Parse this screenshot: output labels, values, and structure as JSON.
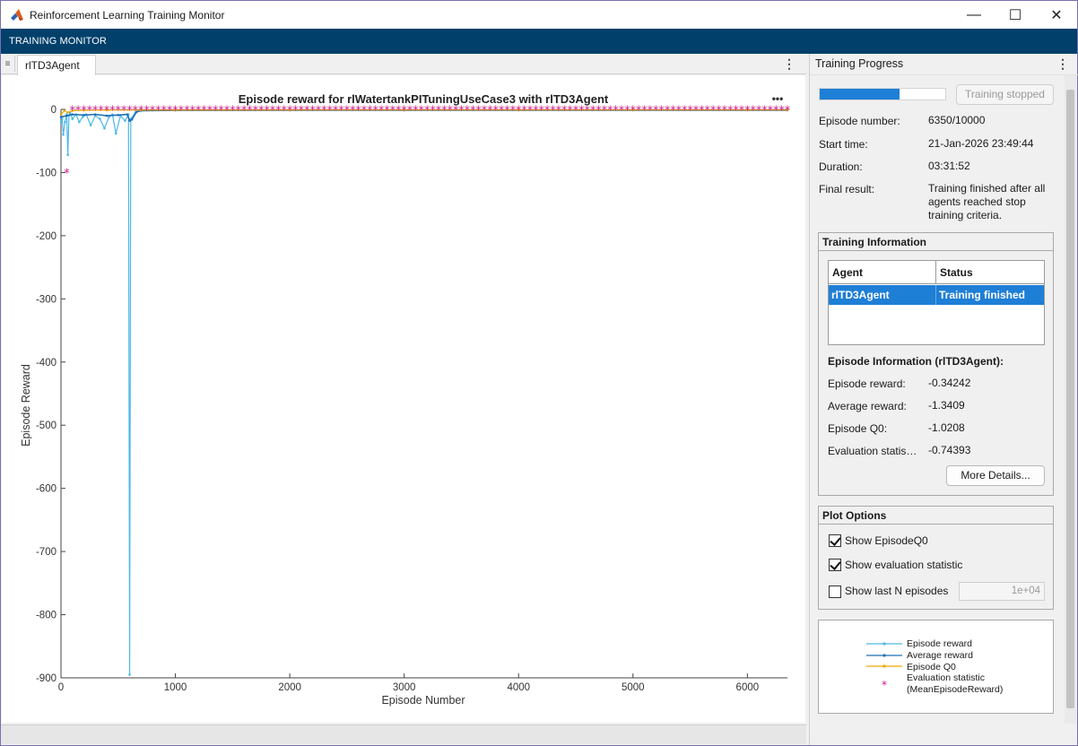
{
  "window": {
    "title": "Reinforcement Learning Training Monitor",
    "minimize": "—",
    "maximize": "☐",
    "close": "✕"
  },
  "banner": {
    "label": "TRAINING MONITOR"
  },
  "tabs": {
    "active": "rlTD3Agent",
    "menu": "⋮",
    "grip": "≡"
  },
  "plot": {
    "more": "•••"
  },
  "progress_panel": {
    "header": "Training Progress",
    "menu": "⋮",
    "progress_fraction": 0.635,
    "stop_button": "Training stopped",
    "fields": [
      {
        "label": "Episode number:",
        "value": "6350/10000"
      },
      {
        "label": "Start time:",
        "value": "21-Jan-2026 23:49:44"
      },
      {
        "label": "Duration:",
        "value": "03:31:52"
      },
      {
        "label": "Final result:",
        "value": "Training finished after all agents reached stop training criteria."
      }
    ]
  },
  "training_info": {
    "title": "Training Information",
    "columns": [
      "Agent",
      "Status"
    ],
    "rows": [
      {
        "agent": "rlTD3Agent",
        "status": "Training finished"
      }
    ],
    "episode_info_title": "Episode Information (rlTD3Agent):",
    "episode_fields": [
      {
        "label": "Episode reward:",
        "value": "-0.34242"
      },
      {
        "label": "Average reward:",
        "value": "-1.3409"
      },
      {
        "label": "Episode Q0:",
        "value": "-1.0208"
      },
      {
        "label": "Evaluation statis…",
        "value": "-0.74393"
      }
    ],
    "more_details": "More Details..."
  },
  "plot_options": {
    "title": "Plot Options",
    "show_q0": {
      "label": "Show EpisodeQ0",
      "checked": true
    },
    "show_eval": {
      "label": "Show evaluation statistic",
      "checked": true
    },
    "show_last_n": {
      "label": "Show last N episodes",
      "checked": false,
      "value": "1e+04"
    }
  },
  "colors": {
    "episode_reward": "#4db8e8",
    "average_reward": "#1f6fb5",
    "episode_q0": "#f0a800",
    "evaluation": "#c8168a"
  },
  "chart_data": {
    "type": "line",
    "title": "Episode reward for rlWatertankPITuningUseCase3 with rlTD3Agent",
    "xlabel": "Episode Number",
    "ylabel": "Episode Reward",
    "xlim": [
      0,
      6350
    ],
    "ylim": [
      -900,
      0
    ],
    "xticks": [
      0,
      1000,
      2000,
      3000,
      4000,
      5000,
      6000
    ],
    "yticks": [
      0,
      -100,
      -200,
      -300,
      -400,
      -500,
      -600,
      -700,
      -800,
      -900
    ],
    "grid": false,
    "legend": {
      "position": "lower panel",
      "entries": [
        "Episode reward",
        "Average reward",
        "Episode Q0",
        "Evaluation statistic",
        "(MeanEpisodeReward)"
      ]
    },
    "series": [
      {
        "name": "Episode reward",
        "x": [
          1,
          10,
          20,
          35,
          50,
          60,
          70,
          80,
          100,
          130,
          160,
          190,
          220,
          260,
          300,
          340,
          380,
          420,
          450,
          480,
          520,
          560,
          590,
          600,
          610,
          650,
          700,
          1000,
          2000,
          3000,
          4000,
          5000,
          6000,
          6350
        ],
        "y": [
          -20,
          -15,
          -40,
          -20,
          -8,
          -72,
          -10,
          -5,
          -15,
          -8,
          -20,
          -12,
          -8,
          -25,
          -10,
          -15,
          -30,
          -12,
          -8,
          -38,
          -10,
          -18,
          -8,
          -895,
          -15,
          -5,
          -1,
          -1,
          -1,
          -1,
          -1,
          -1,
          -1,
          -0.3
        ]
      },
      {
        "name": "Average reward",
        "x": [
          1,
          50,
          100,
          200,
          300,
          400,
          500,
          580,
          600,
          620,
          660,
          700,
          1000,
          2000,
          3000,
          4000,
          5000,
          6000,
          6350
        ],
        "y": [
          -12,
          -10,
          -8,
          -9,
          -8,
          -10,
          -9,
          -8,
          -18,
          -16,
          -4,
          -2,
          -1.5,
          -1.4,
          -1.4,
          -1.3,
          -1.3,
          -1.3,
          -1.3
        ]
      },
      {
        "name": "Episode Q0",
        "x": [
          1,
          30,
          60,
          100,
          200,
          400,
          700,
          1000,
          2000,
          3000,
          4000,
          5000,
          6000,
          6350
        ],
        "y": [
          -8,
          -2,
          -5,
          -2,
          -1.5,
          -1.2,
          -1.1,
          -1.1,
          -1,
          -1,
          -1,
          -1,
          -1,
          -1
        ]
      },
      {
        "name": "Evaluation statistic",
        "x": [
          50,
          100,
          150,
          200,
          250,
          300,
          350,
          400,
          450,
          500,
          550,
          600,
          650,
          700,
          750,
          800,
          850,
          900,
          950,
          1000,
          1050,
          1100,
          1150,
          1200,
          1250,
          1300,
          1350,
          1400,
          1450,
          1500,
          1550,
          1600,
          1650,
          1700,
          1750,
          1800,
          1850,
          1900,
          1950,
          2000,
          2050,
          2100,
          2150,
          2200,
          2250,
          2300,
          2350,
          2400,
          2450,
          2500,
          2550,
          2600,
          2650,
          2700,
          2750,
          2800,
          2850,
          2900,
          2950,
          3000,
          3050,
          3100,
          3150,
          3200,
          3250,
          3300,
          3350,
          3400,
          3450,
          3500,
          3550,
          3600,
          3650,
          3700,
          3750,
          3800,
          3850,
          3900,
          3950,
          4000,
          4050,
          4100,
          4150,
          4200,
          4250,
          4300,
          4350,
          4400,
          4450,
          4500,
          4550,
          4600,
          4650,
          4700,
          4750,
          4800,
          4850,
          4900,
          4950,
          5000,
          5050,
          5100,
          5150,
          5200,
          5250,
          5300,
          5350,
          5400,
          5450,
          5500,
          5550,
          5600,
          5650,
          5700,
          5750,
          5800,
          5850,
          5900,
          5950,
          6000,
          6050,
          6100,
          6150,
          6200,
          6250,
          6300,
          6350
        ],
        "y": [
          -100,
          -1,
          -1,
          -1,
          -1,
          -1,
          -1,
          -1,
          -1,
          -1,
          -1,
          -1,
          -1,
          -1,
          -1,
          -1,
          -1,
          -1,
          -1,
          -1,
          -1,
          -1,
          -1,
          -1,
          -1,
          -1,
          -1,
          -1,
          -1,
          -1,
          -1,
          -1,
          -1,
          -1,
          -1,
          -1,
          -1,
          -1,
          -1,
          -1,
          -1,
          -1,
          -1,
          -1,
          -1,
          -1,
          -1,
          -1,
          -1,
          -1,
          -1,
          -1,
          -1,
          -1,
          -1,
          -1,
          -1,
          -1,
          -1,
          -1,
          -1,
          -1,
          -1,
          -1,
          -1,
          -1,
          -1,
          -1,
          -1,
          -1,
          -1,
          -1,
          -1,
          -1,
          -1,
          -1,
          -1,
          -1,
          -1,
          -1,
          -1,
          -1,
          -1,
          -1,
          -1,
          -1,
          -1,
          -1,
          -1,
          -1,
          -1,
          -1,
          -1,
          -1,
          -1,
          -1,
          -1,
          -1,
          -1,
          -1,
          -1,
          -1,
          -1,
          -1,
          -1,
          -1,
          -1,
          -1,
          -1,
          -1,
          -1,
          -1,
          -1,
          -1,
          -1,
          -1,
          -1,
          -1,
          -1,
          -1,
          -1,
          -1,
          -1,
          -1,
          -1,
          -1,
          -0.74
        ]
      }
    ]
  }
}
